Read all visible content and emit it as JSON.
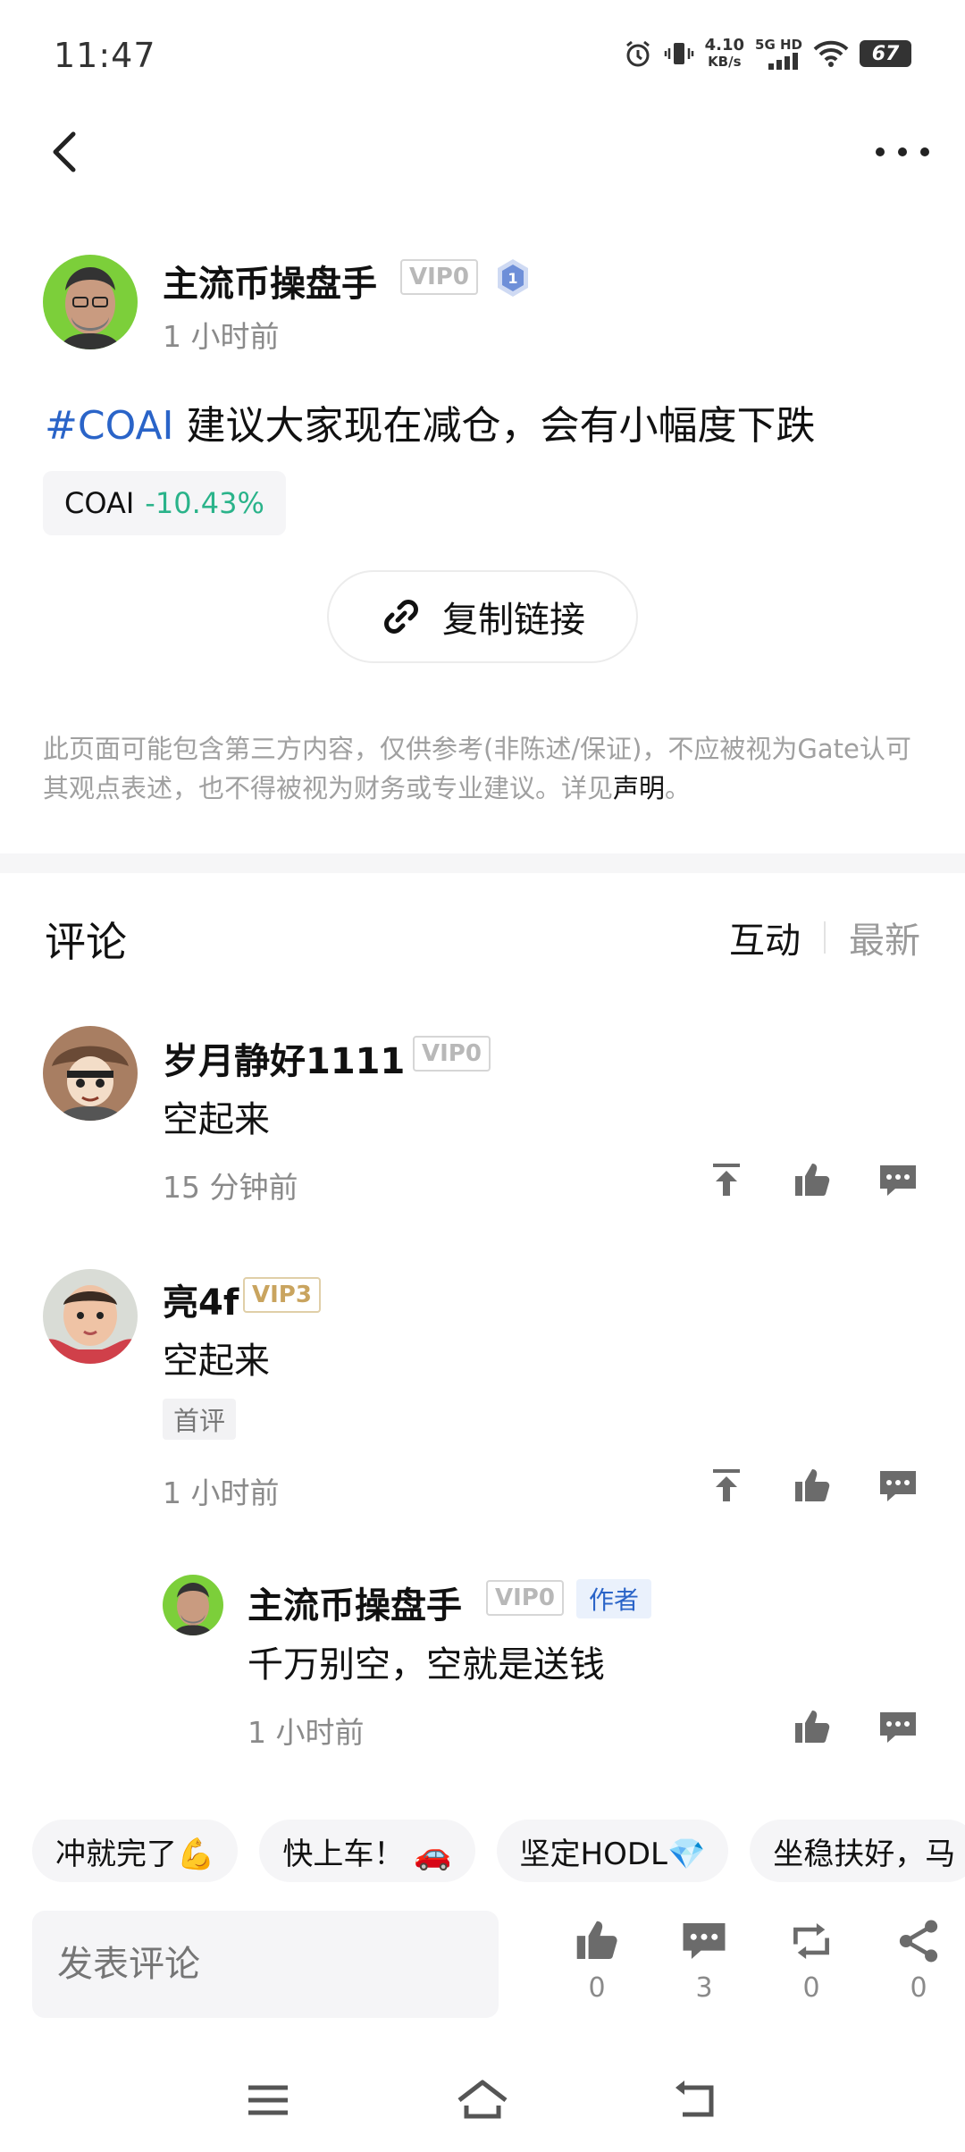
{
  "status_bar": {
    "time": "11:47",
    "speed_value": "4.10",
    "speed_unit": "KB/s",
    "net_label": "5G HD",
    "battery": "67",
    "icons": [
      "alarm-icon",
      "vibrate-icon",
      "signal-icon",
      "wifi-icon",
      "battery-icon"
    ]
  },
  "post": {
    "author": "主流币操盘手",
    "author_vip": "VIP0",
    "level_badge": "1",
    "time": "1 小时前",
    "hashtag": "#COAI",
    "text": " 建议大家现在减仓，会有小幅度下跌",
    "coin": {
      "symbol": "COAI",
      "change": "-10.43%",
      "change_color": "#2ab38a"
    },
    "copy_link_label": "复制链接",
    "disclaimer": "此页面可能包含第三方内容，仅供参考(非陈述/保证)，不应被视为Gate认可其观点表述，也不得被视为财务或专业建议。详见",
    "disclaimer_link": "声明",
    "disclaimer_end": "。"
  },
  "comments_header": {
    "title": "评论",
    "tab_active": "互动",
    "tab_inactive": "最新"
  },
  "comments": [
    {
      "name": "岁月静好1111",
      "vip": "VIP0",
      "text": "空起来",
      "time": "15 分钟前"
    },
    {
      "name": "亮4f",
      "vip": "VIP3",
      "text": "空起来",
      "tag": "首评",
      "time": "1 小时前"
    }
  ],
  "reply": {
    "name": "主流币操盘手",
    "vip": "VIP0",
    "author_tag": "作者",
    "text": "千万别空，空就是送钱",
    "time": "1 小时前"
  },
  "quick_replies": [
    "冲就完了💪",
    "快上车！ 🚗",
    "坚定HODL💎",
    "坐稳扶好，马"
  ],
  "bottom_bar": {
    "input_placeholder": "发表评论",
    "like_count": "0",
    "comment_count": "3",
    "repost_count": "0",
    "share_count": "0"
  },
  "colors": {
    "accent_blue": "#2a64c8",
    "down_green": "#2ab38a",
    "vip_gold": "#c9a45f"
  }
}
